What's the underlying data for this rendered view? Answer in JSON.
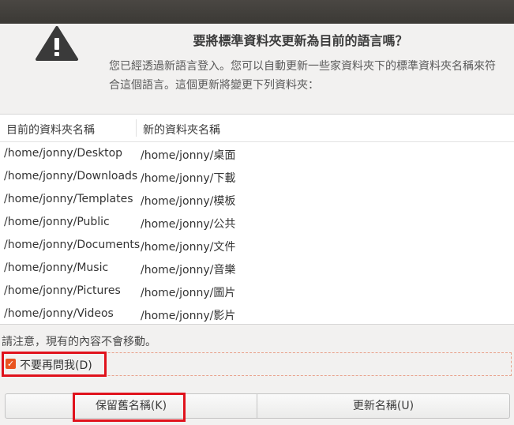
{
  "dialog": {
    "icon": "warning-icon",
    "headline": "要將標準資料夾更新為目前的語言嗎？",
    "description": "您已經透過新語言登入。您可以自動更新一些家資料夾下的標準資料夾名稱來符合這個語言。這個更新將變更下列資料夾：",
    "table": {
      "headers": [
        "目前的資料夾名稱",
        "新的資料夾名稱"
      ],
      "rows": [
        {
          "current": "/home/jonny/Desktop",
          "new": "/home/jonny/桌面"
        },
        {
          "current": "/home/jonny/Downloads",
          "new": "/home/jonny/下載"
        },
        {
          "current": "/home/jonny/Templates",
          "new": "/home/jonny/模板"
        },
        {
          "current": "/home/jonny/Public",
          "new": "/home/jonny/公共"
        },
        {
          "current": "/home/jonny/Documents",
          "new": "/home/jonny/文件"
        },
        {
          "current": "/home/jonny/Music",
          "new": "/home/jonny/音樂"
        },
        {
          "current": "/home/jonny/Pictures",
          "new": "/home/jonny/圖片"
        },
        {
          "current": "/home/jonny/Videos",
          "new": "/home/jonny/影片"
        }
      ]
    },
    "note": "請注意，現有的內容不會移動。",
    "checkbox": {
      "label": "不要再問我(D)",
      "checked": true
    },
    "buttons": {
      "keep": "保留舊名稱(K)",
      "update": "更新名稱(U)"
    },
    "colors": {
      "accent": "#e95420",
      "highlight": "#e0121c",
      "titlebar": "#3b3935"
    }
  }
}
